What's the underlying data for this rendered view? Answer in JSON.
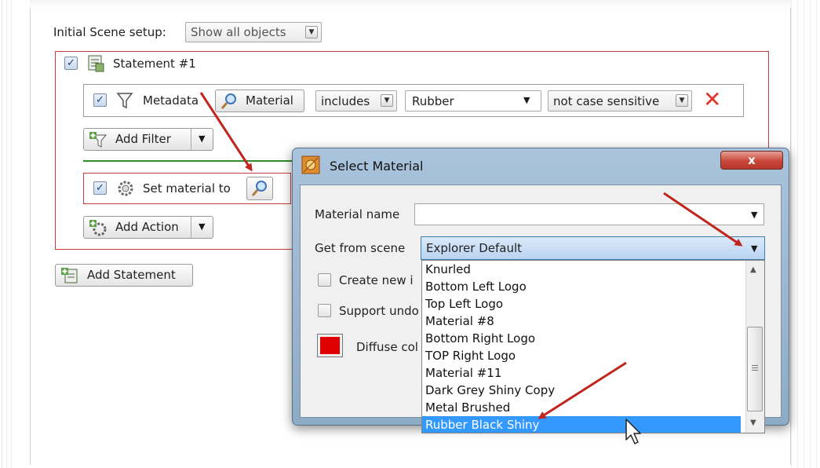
{
  "scene_setup": {
    "label": "Initial Scene setup:",
    "value": "Show all objects"
  },
  "statement": {
    "checked": "✓",
    "title": "Statement #1",
    "filter": {
      "checked": "✓",
      "label": "Metadata",
      "field_button": "Material",
      "operator": "includes",
      "value": "Rubber",
      "case": "not case sensitive",
      "remove_glyph": "✕"
    },
    "add_filter": "Add Filter",
    "action": {
      "checked": "✓",
      "label": "Set material to"
    },
    "add_action": "Add Action"
  },
  "add_statement": "Add Statement",
  "dialog": {
    "title": "Select Material",
    "close_glyph": "x",
    "material_name_label": "Material name",
    "material_name_value": "",
    "get_from_scene_label": "Get from scene",
    "get_from_scene_value": "Explorer Default",
    "create_new_label": "Create new i",
    "support_undo_label": "Support undo",
    "diffuse_label": "Diffuse col",
    "diffuse_color": "#e00000",
    "list_items": [
      "Knurled",
      "Bottom Left Logo",
      "Top Left Logo",
      "Material #8",
      "Bottom Right Logo",
      "TOP Right Logo",
      "Material #11",
      "Dark Grey Shiny Copy",
      "Metal Brushed",
      "Rubber Black Shiny"
    ],
    "selected_item": "Rubber Black Shiny"
  },
  "colors": {
    "highlight": "#3399ff",
    "annotation_arrow": "#c0261d",
    "red_frame": "#c53b3b"
  }
}
